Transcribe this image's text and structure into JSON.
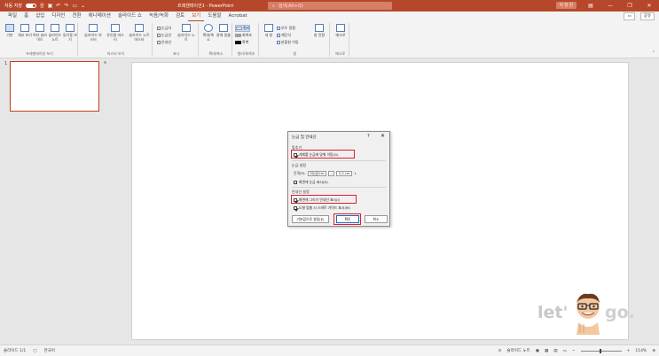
{
  "titlebar": {
    "autosave_label": "자동 저장",
    "autosave_state": "끔",
    "file_name": "프레젠테이션1 - PowerPoint",
    "search_placeholder": "검색(Alt+Q)",
    "user_name": "이 현 진"
  },
  "menu": [
    "파일",
    "홈",
    "삽입",
    "디자인",
    "전환",
    "애니메이션",
    "슬라이드 쇼",
    "녹음/녹화",
    "검토",
    "보기",
    "도움말",
    "Acrobat"
  ],
  "menu_active": "보기",
  "share_labels": {
    "comments": "메모",
    "share": "공유"
  },
  "ribbon": {
    "presentation_views": {
      "caption": "프레젠테이션 보기",
      "buttons": [
        "기본",
        "개요 보기",
        "여러 슬라이드",
        "슬라이드 노트",
        "읽기용 보기"
      ]
    },
    "master_views": {
      "caption": "마스터 보기",
      "buttons": [
        "슬라이드 마스터",
        "유인물 마스터",
        "슬라이드 노트 마스터"
      ]
    },
    "show": {
      "caption": "표시",
      "checks": [
        "눈금자",
        "눈금선",
        "안내선"
      ],
      "notes_button": "슬라이드 노트"
    },
    "zoom": {
      "caption": "확대/축소",
      "buttons": [
        "확대/축소",
        "창에 맞춤"
      ]
    },
    "color": {
      "caption": "컬러/회색조",
      "options": [
        "컬러",
        "회색조",
        "흑백"
      ],
      "colors": [
        "#e8e8e8",
        "#a0a0a0",
        "#111111"
      ]
    },
    "window": {
      "caption": "창",
      "buttons": [
        "새 창",
        "모두 정렬",
        "계단식",
        "분할창 이동",
        "창 전환"
      ]
    },
    "macro": {
      "caption": "매크로",
      "buttons": [
        "매크로"
      ]
    }
  },
  "slides_pane": {
    "slide_number": "1"
  },
  "dialog": {
    "title": "눈금 및 안내선",
    "help": "?",
    "close": "✕",
    "snap_section": "맞추기",
    "snap_option": "개체를 눈금에 맞춰 이동(G)",
    "grid_section": "눈금 설정",
    "spacing_label": "간격(P):",
    "spacing_select": "5눈금/cm",
    "spacing_value": "0.2 cm",
    "show_grid": "화면에 눈금 표시(D)",
    "guides_section": "안내선 설정",
    "show_guides": "화면에 그리기 안내선 표시(I)",
    "smart_guides": "도형 맞춤 시 스마트 가이드 표시(M)",
    "btn_default": "기본값으로 설정(E)",
    "btn_ok": "확인",
    "btn_cancel": "취소",
    "checks": {
      "snap": true,
      "grid": false,
      "guides": true,
      "smart": true
    }
  },
  "watermark": {
    "text_left": "let'",
    "text_right": "go."
  },
  "status": {
    "slide_info": "슬라이드 1/1",
    "language": "한국어",
    "notes_label": "슬라이드 노트",
    "zoom": "114%"
  }
}
